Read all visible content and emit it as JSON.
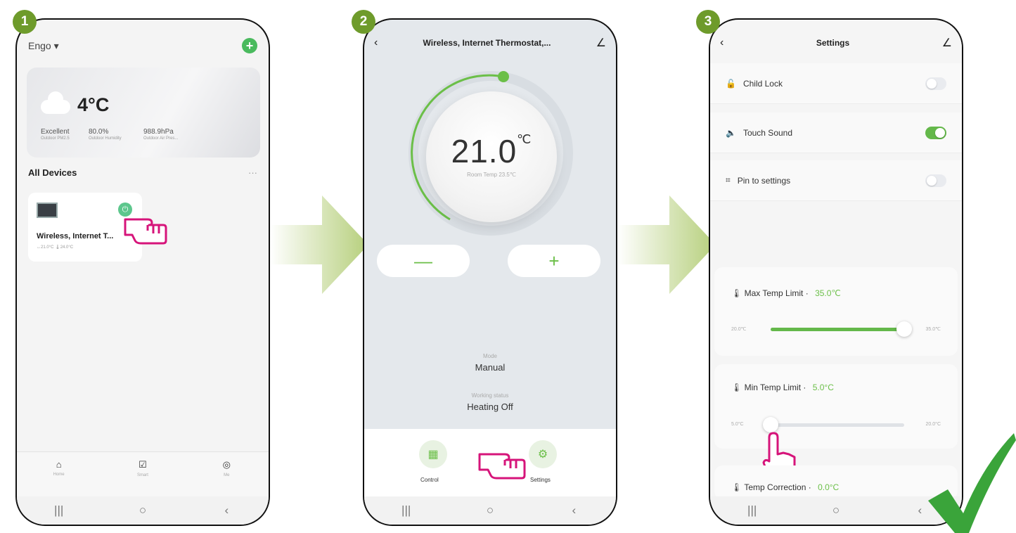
{
  "steps": [
    "1",
    "2",
    "3"
  ],
  "screen1": {
    "home_title": "Engo ▾",
    "weather": {
      "temperature": "4°C",
      "air_quality": "Excellent",
      "air_quality_label": "Outdoor PM2.5",
      "humidity": "80.0%",
      "humidity_label": "Outdoor Humidity",
      "pressure": "988.9hPa",
      "pressure_label": "Outdoor Air Pres..."
    },
    "section_title": "All Devices",
    "more": "···",
    "device": {
      "name": "Wireless, Internet T...",
      "status": "↔21.0°C  🌡24.0°C"
    },
    "tabs": [
      {
        "icon": "home-icon",
        "label": "Home"
      },
      {
        "icon": "smart-icon",
        "label": "Smart"
      },
      {
        "icon": "me-icon",
        "label": "Me"
      }
    ]
  },
  "screen2": {
    "title": "Wireless, Internet Thermostat,...",
    "setpoint": "21.0",
    "setpoint_unit": "℃",
    "room_temp": "Room Temp 23.5℃",
    "minus_label": "—",
    "plus_label": "+",
    "mode_label": "Mode",
    "mode_value": "Manual",
    "status_label": "Working status",
    "status_value": "Heating Off",
    "control_label": "Control",
    "settings_label": "Settings"
  },
  "screen3": {
    "title": "Settings",
    "child_lock": "Child Lock",
    "touch_sound": "Touch Sound",
    "pin_settings": "Pin to settings",
    "toggles": {
      "child_lock": false,
      "touch_sound": true,
      "pin_to_settings": false
    },
    "max_limit_label": "Max Temp Limit",
    "max_limit_value": "35.0℃",
    "max_slider_min": "20.0℃",
    "max_slider_max": "35.0℃",
    "max_slider_fraction": 1.0,
    "min_limit_label": "Min Temp Limit",
    "min_limit_value": "5.0°C",
    "min_slider_min": "5.0°C",
    "min_slider_max": "20.0°C",
    "min_slider_fraction": 0.0,
    "temp_correction_label": "Temp Correction",
    "temp_correction_value": "0.0°C"
  },
  "system_nav": {
    "recent": "|||",
    "home": "○",
    "back": "‹"
  },
  "colors": {
    "accent_green": "#6bbf48",
    "badge_green": "#6e9b2b",
    "arrow_green": "#b6cf7c",
    "pointer_magenta": "#d6147a",
    "check_green": "#3aa43a"
  }
}
